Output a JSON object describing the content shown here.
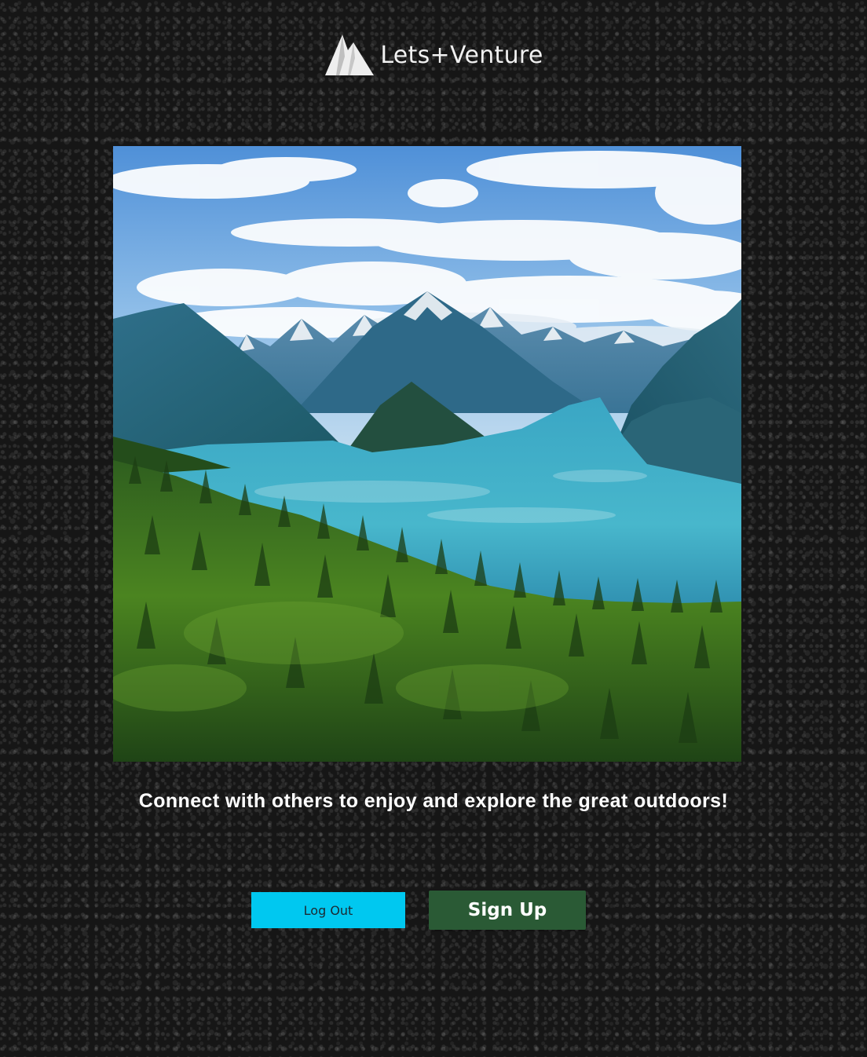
{
  "header": {
    "brand_name": "Lets+Venture",
    "logo_icon": "mountain-logo-icon"
  },
  "hero": {
    "image": "mountain-lake-forest-landscape"
  },
  "tagline": "Connect with others to enjoy and explore the great outdoors!",
  "actions": {
    "logout_label": "Log Out",
    "signup_label": "Sign Up"
  },
  "colors": {
    "logout_button": "#00c8f0",
    "signup_button": "#2a5a35",
    "background": "#161616"
  }
}
